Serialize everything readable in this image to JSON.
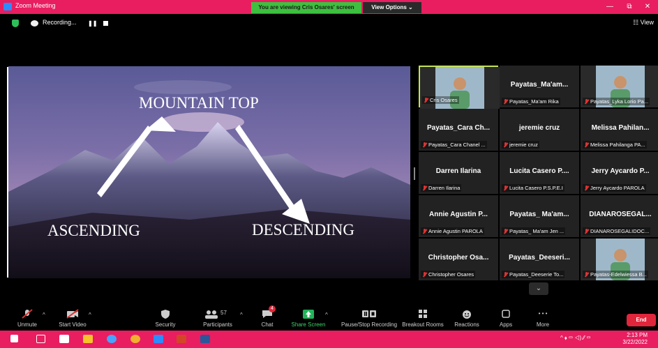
{
  "titlebar": {
    "title": "Zoom Meeting",
    "viewing_banner": "You are viewing Cris Osares' screen",
    "view_options": "View Options ⌄",
    "minimize": "—",
    "maximize": "⧉",
    "close": "✕"
  },
  "recording": {
    "label": "Recording...",
    "pause": "❚❚",
    "view_button": "☷ View"
  },
  "slide": {
    "title": "MOUNTAIN TOP",
    "left_label": "ASCENDING",
    "right_label": "DESCENDING"
  },
  "gallery": {
    "tiles": [
      {
        "name": "",
        "label": "Cris Osares",
        "video": true,
        "active": true
      },
      {
        "name": "Payatas_Ma'am...",
        "label": "Payatas_Ma'am Rika"
      },
      {
        "name": "",
        "label": "Payatas_Lyka Lorio Pa...",
        "video": true
      },
      {
        "name": "Payatas_Cara Ch...",
        "label": "Payatas_Cara Chanel ..."
      },
      {
        "name": "jeremie cruz",
        "label": "jeremie cruz"
      },
      {
        "name": "Melissa Pahilan...",
        "label": "Melissa Pahilanga PA..."
      },
      {
        "name": "Darren Ilarina",
        "label": "Darren Ilarina"
      },
      {
        "name": "Lucita Casero P....",
        "label": "Lucita Casero P.S.P.E.I"
      },
      {
        "name": "Jerry Aycardo P...",
        "label": "Jerry Aycardo PAROLA"
      },
      {
        "name": "Annie Agustin P...",
        "label": "Annie Agustin PAROLA"
      },
      {
        "name": "Payatas_ Ma'am...",
        "label": "Payatas_ Ma'am Jen ..."
      },
      {
        "name": "DIANAROSEGAL...",
        "label": "DIANAROSEGALIDOC..."
      },
      {
        "name": "Christopher Osa...",
        "label": "Christopher Osares"
      },
      {
        "name": "Payatas_Deeseri...",
        "label": "Payatas_Deeserie To..."
      },
      {
        "name": "",
        "label": "Payatas-Edelwiessa B...",
        "video": true
      }
    ],
    "scroll_down": "⌄"
  },
  "toolbar": {
    "unmute": "Unmute",
    "start_video": "Start Video",
    "security": "Security",
    "participants": "Participants",
    "participant_count": "57",
    "chat": "Chat",
    "chat_badge": "4",
    "share_screen": "Share Screen",
    "pause_recording": "Pause/Stop Recording",
    "breakout_rooms": "Breakout Rooms",
    "reactions": "Reactions",
    "apps": "Apps",
    "more": "More",
    "more_dots": "• • •",
    "end": "End",
    "caret": "^"
  },
  "taskbar": {
    "time": "2:13 PM",
    "date": "3/22/2022",
    "tray": "^  ⬧  ▭  ◁)  ⁄⁄  ▭"
  },
  "colors": {
    "accent": "#e81e60",
    "banner": "#3fbf3f",
    "end": "#e0263b",
    "active_border": "#c3e356"
  }
}
